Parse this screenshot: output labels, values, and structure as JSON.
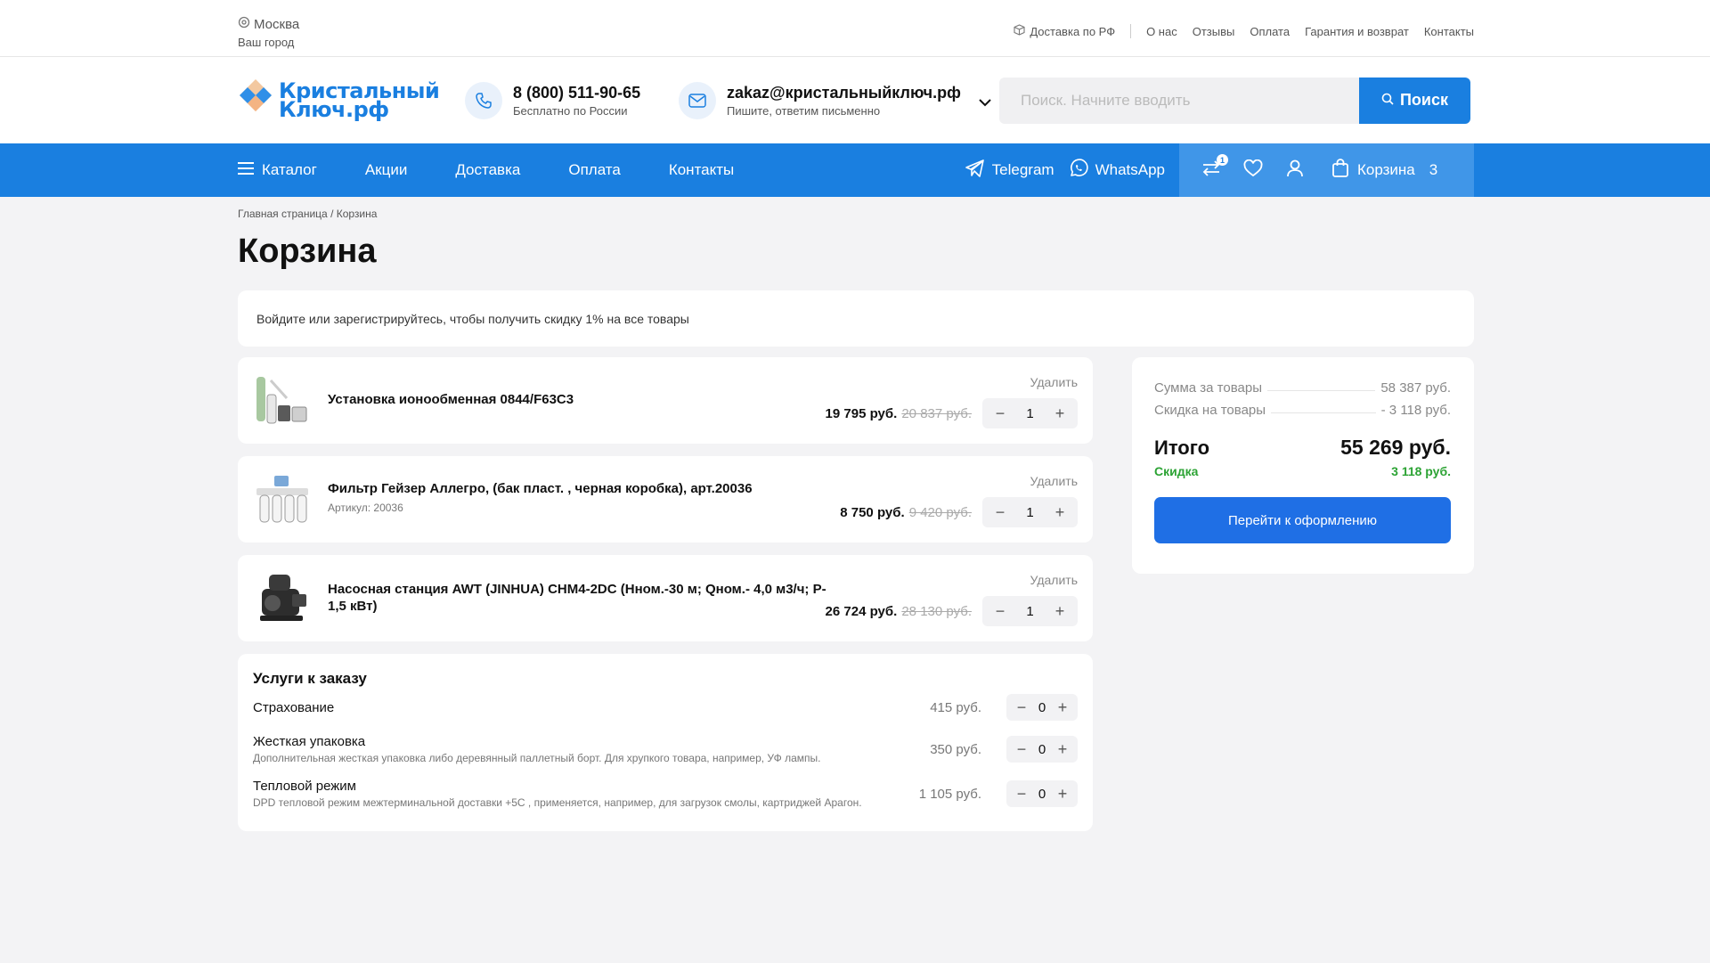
{
  "topbar": {
    "city": "Москва",
    "city_sub": "Ваш город",
    "delivery": "Доставка по РФ",
    "links": [
      "О нас",
      "Отзывы",
      "Оплата",
      "Гарантия и возврат",
      "Контакты"
    ]
  },
  "header": {
    "logo_line1": "Кристальный",
    "logo_line2": "Ключ.рф",
    "phone": "8 (800) 511-90-65",
    "phone_sub": "Бесплатно по России",
    "email": "zakaz@кристальныйключ.рф",
    "email_sub": "Пишите, ответим письменно",
    "search_placeholder": "Поиск. Начните вводить",
    "search_button": "Поиск"
  },
  "nav": {
    "catalog": "Каталог",
    "items": [
      "Акции",
      "Доставка",
      "Оплата",
      "Контакты"
    ],
    "telegram": "Telegram",
    "whatsapp": "WhatsApp",
    "compare_badge": "1",
    "cart_label": "Корзина",
    "cart_count": "3"
  },
  "breadcrumb": "Главная страница / Корзина",
  "page_title": "Корзина",
  "promo": "Войдите или зарегистрируйтесь, чтобы получить скидку 1% на все товары",
  "cart": {
    "delete_label": "Удалить",
    "items": [
      {
        "name": "Установка ионообменная 0844/F63C3",
        "sku": "",
        "price": "19 795 руб.",
        "old_price": "20 837 руб.",
        "qty": "1"
      },
      {
        "name": "Фильтр Гейзер Аллегро, (бак пласт. , черная коробка), арт.20036",
        "sku": "Артикул: 20036",
        "price": "8 750 руб.",
        "old_price": "9 420 руб.",
        "qty": "1"
      },
      {
        "name": "Насосная станция AWT (JINHUA) CHM4-2DC (Нном.-30 м; Qном.- 4,0 м3/ч; P-1,5 кВт)",
        "sku": "",
        "price": "26 724 руб.",
        "old_price": "28 130 руб.",
        "qty": "1"
      }
    ]
  },
  "services": {
    "title": "Услуги к заказу",
    "items": [
      {
        "name": "Страхование",
        "desc": "",
        "price": "415 руб.",
        "qty": "0"
      },
      {
        "name": "Жесткая упаковка",
        "desc": "Дополнительная жесткая упаковка либо деревянный паллетный борт. Для хрупкого товара, например, УФ лампы.",
        "price": "350 руб.",
        "qty": "0"
      },
      {
        "name": "Тепловой режим",
        "desc": "DPD тепловой режим межтерминальной доставки +5С , применяется, например, для загрузок смолы, картриджей Арагон.",
        "price": "1 105 руб.",
        "qty": "0"
      }
    ]
  },
  "summary": {
    "goods_label": "Сумма за товары",
    "goods_value": "58 387 руб.",
    "discount_label": "Скидка на товары",
    "discount_value": "- 3 118 руб.",
    "total_label": "Итого",
    "total_value": "55 269 руб.",
    "saving_label": "Скидка",
    "saving_value": "3 118 руб.",
    "checkout": "Перейти к оформлению"
  },
  "colors": {
    "brand": "#1a7fe0",
    "checkout": "#1f6fe5",
    "discount": "#2ca334"
  }
}
